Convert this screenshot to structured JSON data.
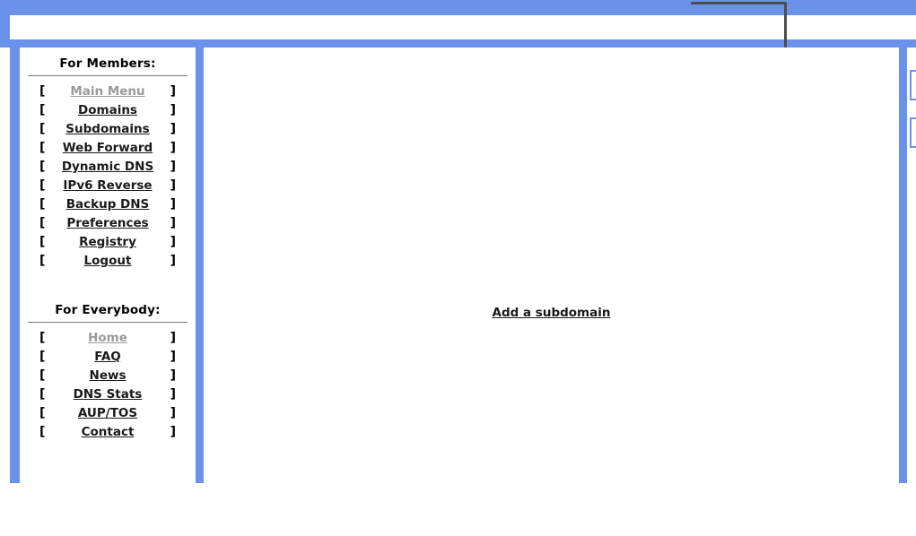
{
  "page": {
    "background_color": "#ffffff",
    "accent_color": "#6a92ea",
    "frame_line_color": "#4d4d4d",
    "rule_color": "#777777",
    "link_color": "#1a1a1a",
    "muted_link_color": "#9a9a9a"
  },
  "sidebar": {
    "members": {
      "heading": "For Members:",
      "items": [
        {
          "label": "Main Menu",
          "open_bracket": "[",
          "close_bracket": "]",
          "state": "muted"
        },
        {
          "label": "Domains",
          "open_bracket": "[",
          "close_bracket": "]",
          "state": "active"
        },
        {
          "label": "Subdomains",
          "open_bracket": "[",
          "close_bracket": "]",
          "state": "active"
        },
        {
          "label": "Web Forward",
          "open_bracket": "[",
          "close_bracket": "]",
          "state": "active"
        },
        {
          "label": "Dynamic DNS",
          "open_bracket": "[",
          "close_bracket": "]",
          "state": "active"
        },
        {
          "label": "IPv6 Reverse",
          "open_bracket": "[",
          "close_bracket": "]",
          "state": "active"
        },
        {
          "label": "Backup DNS",
          "open_bracket": "[",
          "close_bracket": "]",
          "state": "active"
        },
        {
          "label": "Preferences",
          "open_bracket": "[",
          "close_bracket": "]",
          "state": "active"
        },
        {
          "label": "Registry",
          "open_bracket": "[",
          "close_bracket": "]",
          "state": "active"
        },
        {
          "label": "Logout",
          "open_bracket": "[",
          "close_bracket": "]",
          "state": "active"
        }
      ]
    },
    "everybody": {
      "heading": "For Everybody:",
      "items": [
        {
          "label": "Home",
          "open_bracket": "[",
          "close_bracket": "]",
          "state": "muted"
        },
        {
          "label": "FAQ",
          "open_bracket": "[",
          "close_bracket": "]",
          "state": "active"
        },
        {
          "label": "News",
          "open_bracket": "[",
          "close_bracket": "]",
          "state": "active"
        },
        {
          "label": "DNS Stats",
          "open_bracket": "[",
          "close_bracket": "]",
          "state": "active"
        },
        {
          "label": "AUP/TOS",
          "open_bracket": "[",
          "close_bracket": "]",
          "state": "active"
        },
        {
          "label": "Contact",
          "open_bracket": "[",
          "close_bracket": "]",
          "state": "active"
        }
      ]
    }
  },
  "main": {
    "add_subdomain_label": "Add a subdomain"
  }
}
